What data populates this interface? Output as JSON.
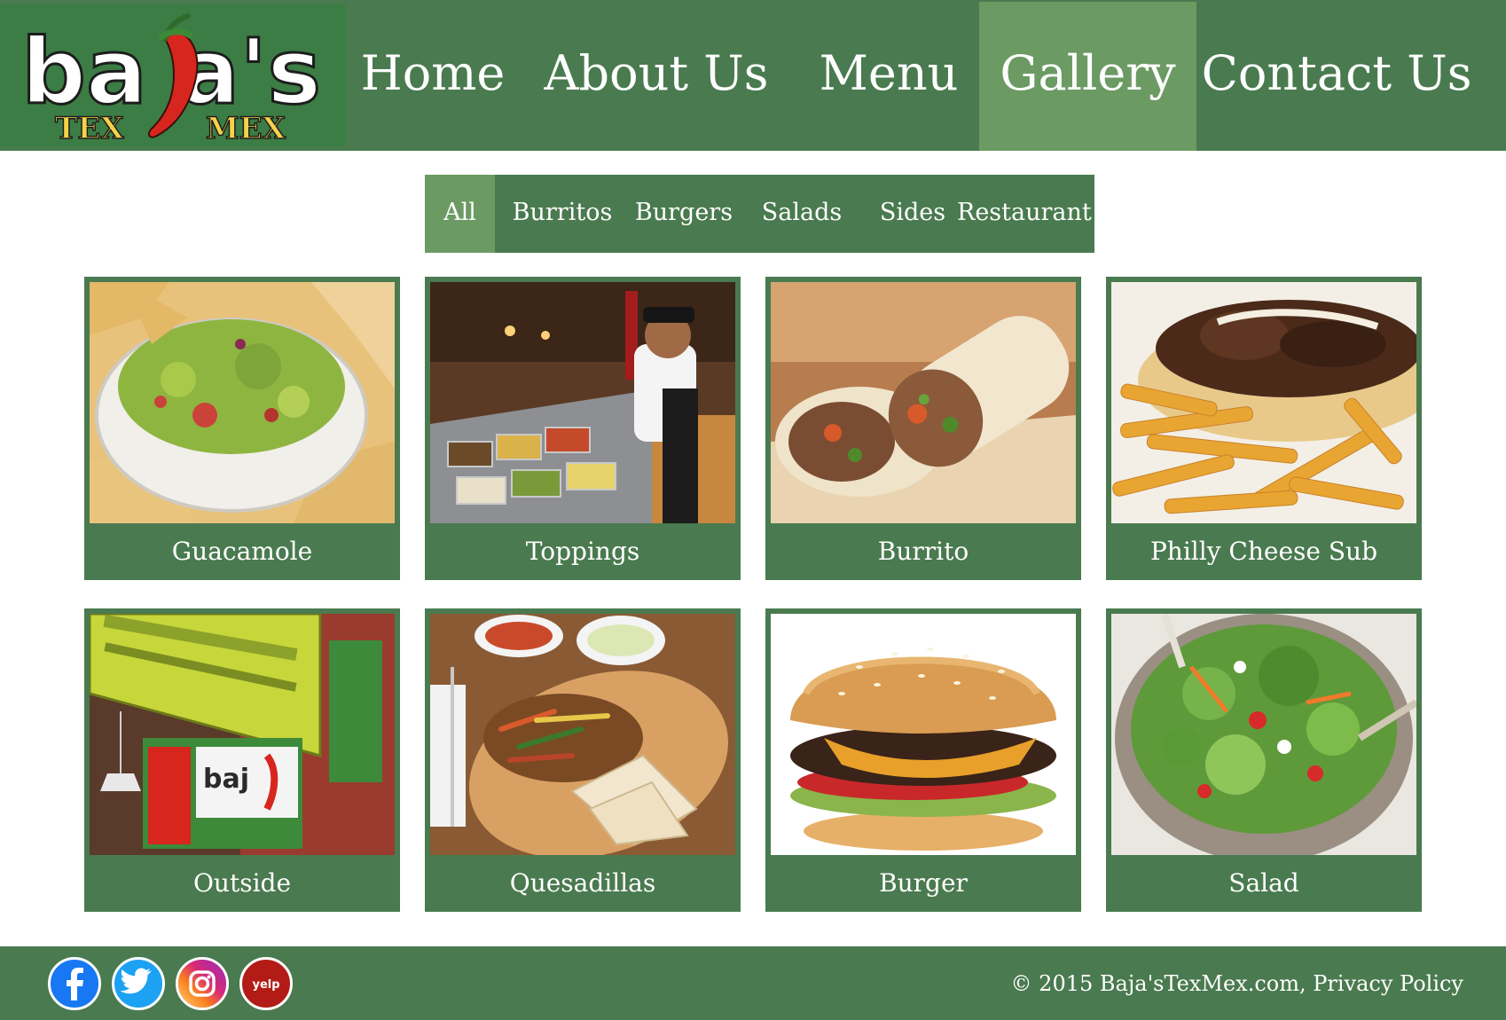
{
  "header": {
    "logo_name": "ba  a's",
    "logo_sub_left": "TEX",
    "logo_sub_right": "MEX",
    "nav": [
      {
        "label": "Home"
      },
      {
        "label": "About Us"
      },
      {
        "label": "Menu"
      },
      {
        "label": "Gallery",
        "active": true
      },
      {
        "label": "Contact Us"
      }
    ]
  },
  "filters": [
    {
      "label": "All",
      "active": true
    },
    {
      "label": "Burritos"
    },
    {
      "label": "Burgers"
    },
    {
      "label": "Salads"
    },
    {
      "label": "Sides"
    },
    {
      "label": "Restaurant"
    }
  ],
  "gallery": [
    {
      "caption": "Guacamole"
    },
    {
      "caption": "Toppings"
    },
    {
      "caption": "Burrito"
    },
    {
      "caption": "Philly Cheese Sub"
    },
    {
      "caption": "Outside"
    },
    {
      "caption": "Quesadillas"
    },
    {
      "caption": "Burger"
    },
    {
      "caption": "Salad"
    }
  ],
  "footer": {
    "social": [
      {
        "name": "facebook-icon",
        "color": "#1877f2"
      },
      {
        "name": "twitter-icon",
        "color": "#1da1f2"
      },
      {
        "name": "instagram-icon",
        "color": "#d62976"
      },
      {
        "name": "yelp-icon",
        "color": "#b31c16",
        "text": "yelp"
      }
    ],
    "copyright": "© 2015 Baja'sTexMex.com, Privacy Policy"
  },
  "colors": {
    "header_green": "#4a7a4f",
    "active_green": "#6b9a63",
    "logo_green": "#3c7d45",
    "pepper_red": "#d7261e",
    "logo_yellow": "#f6d24a"
  }
}
